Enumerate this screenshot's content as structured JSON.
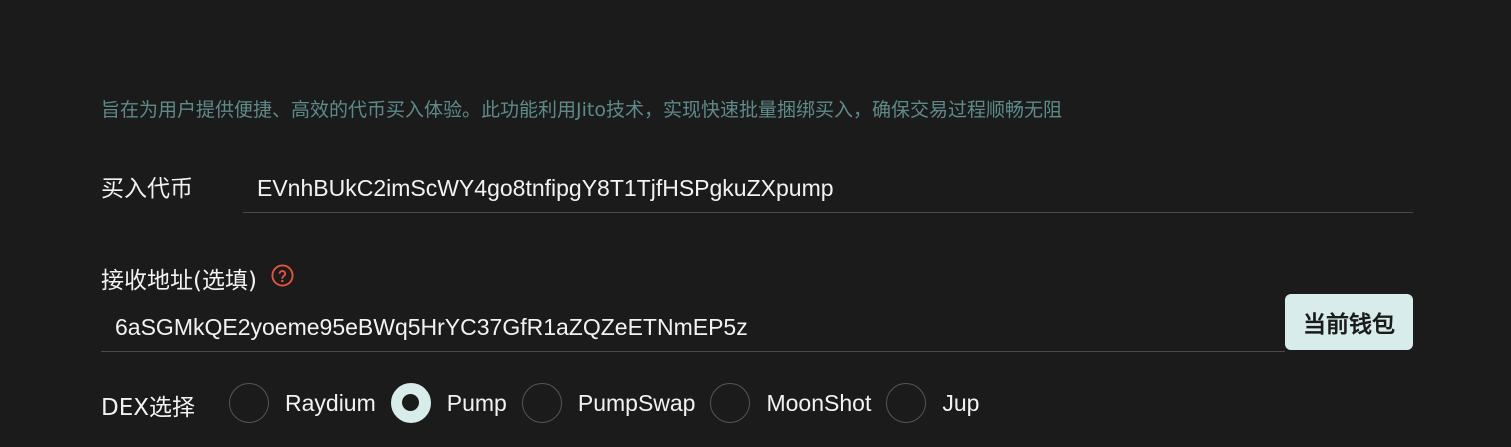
{
  "description": "旨在为用户提供便捷、高效的代币买入体验。此功能利用Jito技术，实现快速批量捆绑买入，确保交易过程顺畅无阻",
  "buy_token": {
    "label": "买入代币",
    "value": "EVnhBUkC2imScWY4go8tnfipgY8T1TjfHSPgkuZXpump"
  },
  "receive_address": {
    "label": "接收地址(选填)",
    "help_icon": "question-circle-icon",
    "value": "6aSGMkQE2yoeme95eBWq5HrYC37GfR1aZQZeETNmEP5z",
    "wallet_button_label": "当前钱包"
  },
  "dex": {
    "label": "DEX选择",
    "options": [
      {
        "label": "Raydium",
        "checked": false
      },
      {
        "label": "Pump",
        "checked": true
      },
      {
        "label": "PumpSwap",
        "checked": false
      },
      {
        "label": "MoonShot",
        "checked": false
      },
      {
        "label": "Jup",
        "checked": false
      }
    ]
  },
  "colors": {
    "background": "#1b1b1b",
    "description_text": "#5e8a8a",
    "accent": "#d9ecec",
    "help_icon": "#e5533d"
  }
}
